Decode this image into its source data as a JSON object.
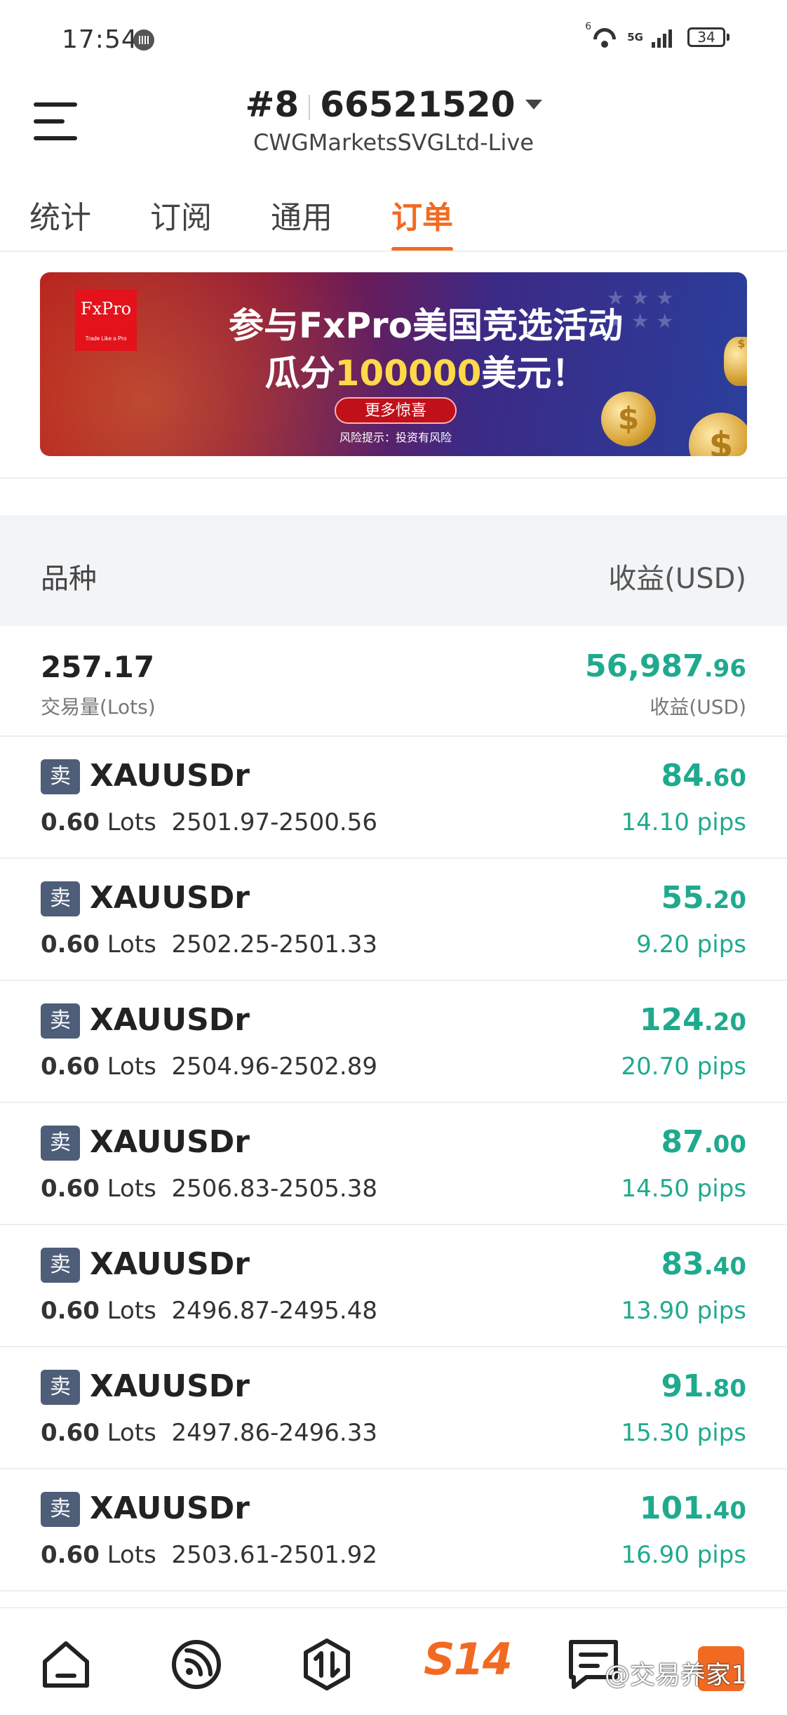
{
  "status_bar": {
    "time": "17:54",
    "wifi_label": "6",
    "network": "5G",
    "battery": "34"
  },
  "header": {
    "account_prefix": "#8",
    "account_number": "66521520",
    "server": "CWGMarketsSVGLtd-Live"
  },
  "tabs": [
    {
      "label": "统计"
    },
    {
      "label": "订阅"
    },
    {
      "label": "通用"
    },
    {
      "label": "订单",
      "active": true
    }
  ],
  "banner": {
    "logo_text": "FxPro",
    "logo_tagline": "Trade Like a Pro",
    "title": "参与FxPro美国竞选活动",
    "subtitle_prefix": "瓜分",
    "subtitle_amount": "100000",
    "subtitle_suffix": "美元！",
    "button": "更多惊喜",
    "risk": "风险提示：投资有风险"
  },
  "table_header": {
    "left": "品种",
    "right": "收益(USD)"
  },
  "summary": {
    "lots": "257.17",
    "lots_label": "交易量(Lots)",
    "profit_int": "56,987",
    "profit_dec": ".96",
    "profit_label": "收益(USD)"
  },
  "orders": [
    {
      "side": "卖",
      "symbol": "XAUUSDr",
      "lots": "0.60",
      "lots_unit": "Lots",
      "range": "2501.97-2500.56",
      "profit_int": "84",
      "profit_dec": ".60",
      "pips": "14.10 pips"
    },
    {
      "side": "卖",
      "symbol": "XAUUSDr",
      "lots": "0.60",
      "lots_unit": "Lots",
      "range": "2502.25-2501.33",
      "profit_int": "55",
      "profit_dec": ".20",
      "pips": "9.20 pips"
    },
    {
      "side": "卖",
      "symbol": "XAUUSDr",
      "lots": "0.60",
      "lots_unit": "Lots",
      "range": "2504.96-2502.89",
      "profit_int": "124",
      "profit_dec": ".20",
      "pips": "20.70 pips"
    },
    {
      "side": "卖",
      "symbol": "XAUUSDr",
      "lots": "0.60",
      "lots_unit": "Lots",
      "range": "2506.83-2505.38",
      "profit_int": "87",
      "profit_dec": ".00",
      "pips": "14.50 pips"
    },
    {
      "side": "卖",
      "symbol": "XAUUSDr",
      "lots": "0.60",
      "lots_unit": "Lots",
      "range": "2496.87-2495.48",
      "profit_int": "83",
      "profit_dec": ".40",
      "pips": "13.90 pips"
    },
    {
      "side": "卖",
      "symbol": "XAUUSDr",
      "lots": "0.60",
      "lots_unit": "Lots",
      "range": "2497.86-2496.33",
      "profit_int": "91",
      "profit_dec": ".80",
      "pips": "15.30 pips"
    },
    {
      "side": "卖",
      "symbol": "XAUUSDr",
      "lots": "0.60",
      "lots_unit": "Lots",
      "range": "2503.61-2501.92",
      "profit_int": "101",
      "profit_dec": ".40",
      "pips": "16.90 pips"
    }
  ],
  "bottom_nav": {
    "items": [
      {
        "icon": "home-icon"
      },
      {
        "icon": "signal-feed-icon"
      },
      {
        "icon": "trade-icon"
      },
      {
        "icon": "s14-icon",
        "label": "S14",
        "active": true
      },
      {
        "icon": "notes-icon"
      }
    ],
    "watermark": "@交易养家1"
  },
  "colors": {
    "accent": "#f26a21",
    "profit": "#1faa8e",
    "sell_badge": "#4e5d78"
  }
}
